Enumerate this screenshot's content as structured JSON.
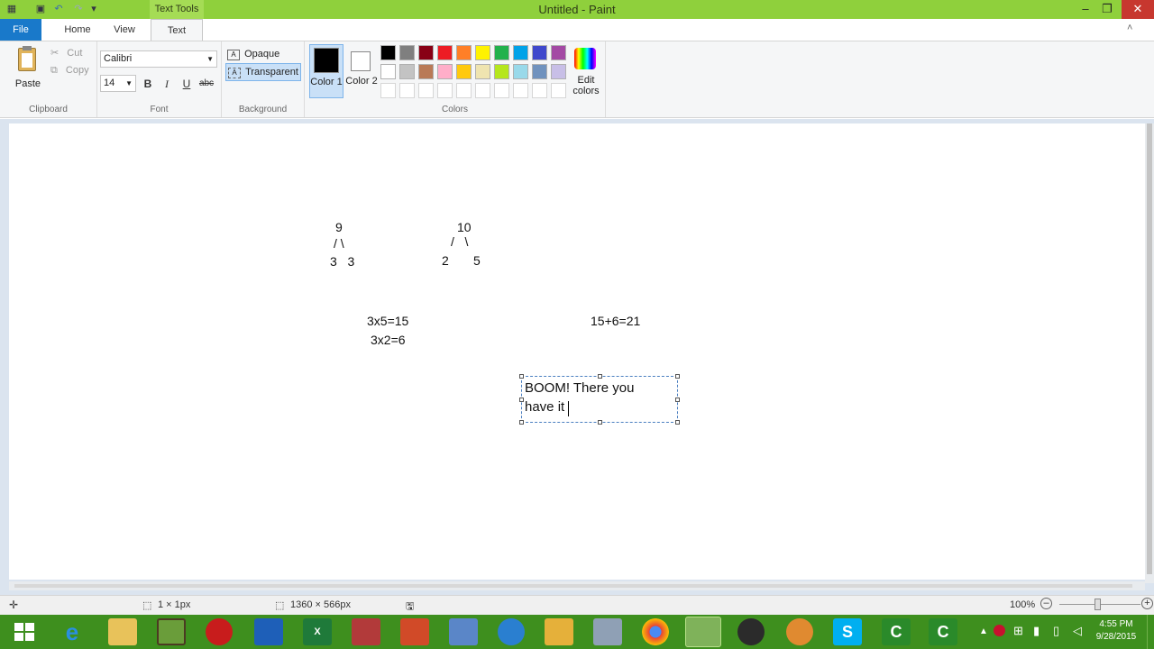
{
  "titlebar": {
    "title": "Untitled - Paint",
    "context_tab": "Text Tools",
    "minimize": "–",
    "restore": "❐",
    "close": "✕"
  },
  "tabs": [
    {
      "label": "File"
    },
    {
      "label": "Home"
    },
    {
      "label": "View"
    },
    {
      "label": "Text"
    }
  ],
  "clipboard": {
    "paste": "Paste",
    "cut": "Cut",
    "copy": "Copy",
    "group": "Clipboard"
  },
  "font": {
    "family": "Calibri",
    "size": "14",
    "bold": "B",
    "italic": "I",
    "underline": "U",
    "strike": "abc",
    "group": "Font"
  },
  "background": {
    "opaque": "Opaque",
    "transparent": "Transparent",
    "group": "Background"
  },
  "colors": {
    "color1": "Color 1",
    "color2": "Color 2",
    "edit": "Edit colors",
    "group": "Colors",
    "palette_row1": [
      "#000000",
      "#7f7f7f",
      "#880015",
      "#ed1c24",
      "#ff7f27",
      "#fff200",
      "#22b14c",
      "#00a2e8",
      "#3f48cc",
      "#a349a4"
    ],
    "palette_row2": [
      "#ffffff",
      "#c3c3c3",
      "#b97a57",
      "#ffaec9",
      "#ffc90e",
      "#efe4b0",
      "#b5e61d",
      "#99d9ea",
      "#7092be",
      "#c8bfe7"
    ]
  },
  "canvas": {
    "tree1_top": "9",
    "tree1_branch": "/ \\",
    "tree1_bottom": "3   3",
    "tree2_top": "10",
    "tree2_branch": "/   \\",
    "tree2_bottom": "2       5",
    "eq1": "3x5=15",
    "eq2": "3x2=6",
    "eq3": "15+6=21",
    "textbox_line1": "BOOM! There you",
    "textbox_line2": "have it"
  },
  "status": {
    "selection": "1 × 1px",
    "canvas_size": "1360 × 566px",
    "zoom": "100%"
  },
  "tray": {
    "time": "4:55 PM",
    "date": "9/28/2015"
  }
}
